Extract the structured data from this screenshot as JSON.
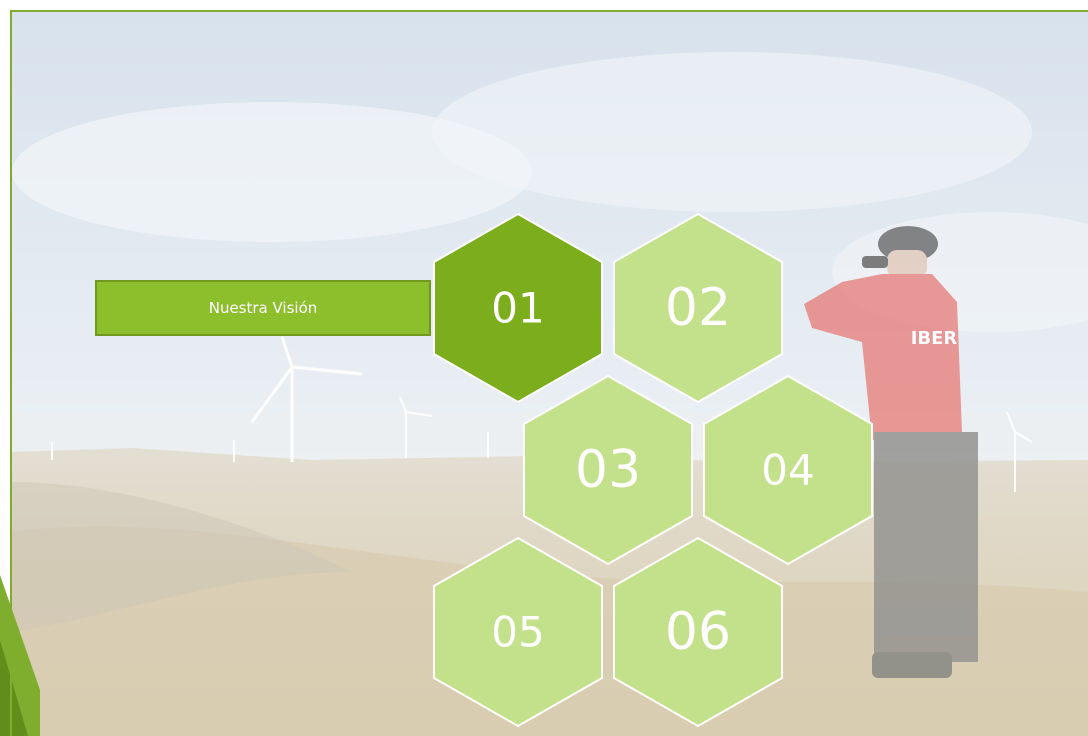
{
  "slide": {
    "active_item_label": "Nuestra Visión"
  },
  "hexagons": [
    {
      "label": "01",
      "state": "active"
    },
    {
      "label": "02",
      "state": "inactive"
    },
    {
      "label": "03",
      "state": "inactive"
    },
    {
      "label": "04",
      "state": "inactive"
    },
    {
      "label": "05",
      "state": "inactive"
    },
    {
      "label": "06",
      "state": "inactive"
    }
  ],
  "colors": {
    "accent_green": "#8cbf2b",
    "active_hex": "#7cad1c",
    "inactive_hex": "#c3e08a",
    "hex_border": "#ffffff",
    "frame_border": "#7fae2f"
  },
  "background": {
    "description_icon": "wind-farm-landscape-image",
    "badge_text": "IBER"
  }
}
